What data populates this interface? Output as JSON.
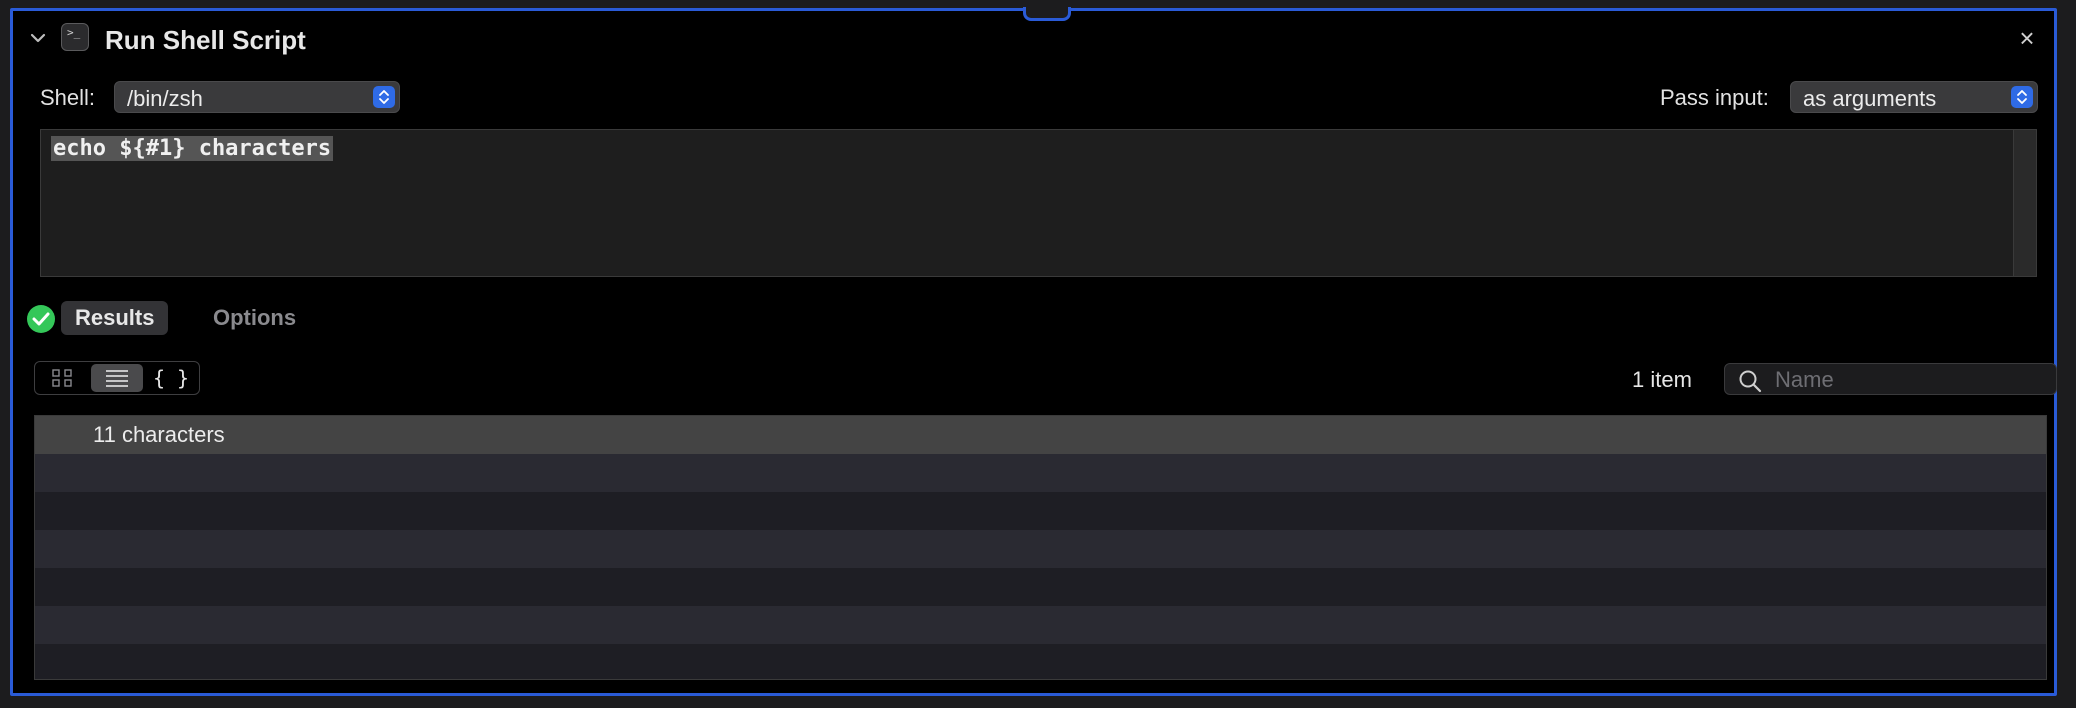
{
  "header": {
    "title": "Run Shell Script",
    "close_glyph": "×"
  },
  "shell": {
    "label": "Shell:",
    "value": "/bin/zsh"
  },
  "pass_input": {
    "label": "Pass input:",
    "value": "as arguments"
  },
  "editor": {
    "code": "echo ${#1} characters"
  },
  "tabs": {
    "results": "Results",
    "options": "Options"
  },
  "view_modes": {
    "json_label": "{ }"
  },
  "results": {
    "count_label": "1 item",
    "search_placeholder": "Name",
    "rows": [
      "11 characters"
    ]
  },
  "colors": {
    "accent": "#2a5bd7",
    "stepper": "#2f6be6",
    "success": "#34c759",
    "row_selected": "#444444",
    "row_even": "#2a2a32",
    "row_odd": "#1e1e24"
  },
  "icons": [
    "chevron-down-icon",
    "terminal-icon",
    "close-icon",
    "checkmark-icon",
    "grid-view-icon",
    "list-view-icon",
    "search-icon"
  ]
}
